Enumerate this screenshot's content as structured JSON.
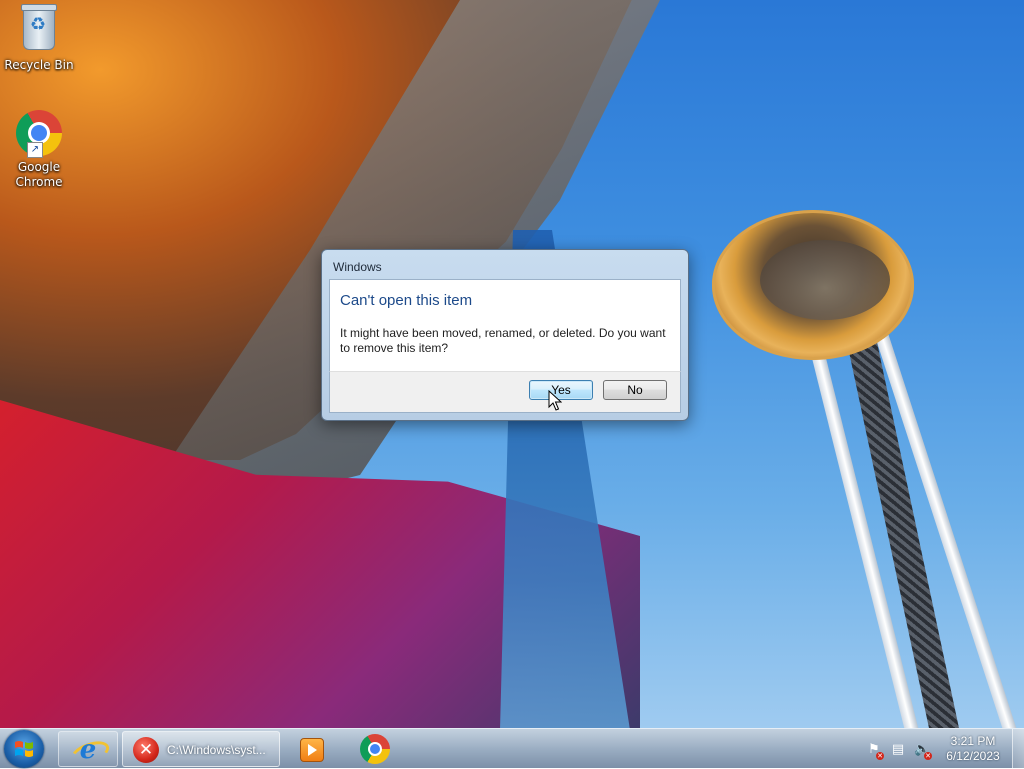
{
  "desktop": {
    "icons": [
      {
        "label": "Recycle Bin",
        "icon": "recycle-bin-icon"
      },
      {
        "label": "Google Chrome",
        "icon": "chrome-icon",
        "shortcut": true
      }
    ]
  },
  "dialog": {
    "title": "Windows",
    "heading": "Can't open this item",
    "message": "It might have been moved, renamed, or deleted. Do you want to remove this item?",
    "yes_label": "Yes",
    "no_label": "No",
    "heading_color": "#1d4a8a"
  },
  "taskbar": {
    "start_icon": "windows-logo-icon",
    "items": [
      {
        "icon": "internet-explorer-icon"
      },
      {
        "icon": "error-icon",
        "label": "C:\\Windows\\syst..."
      },
      {
        "icon": "windows-media-player-icon"
      },
      {
        "icon": "chrome-icon"
      }
    ],
    "tray": {
      "icons": [
        "action-center-flag-icon",
        "network-icon",
        "volume-muted-icon"
      ],
      "time": "3:21 PM",
      "date": "6/12/2023"
    }
  }
}
